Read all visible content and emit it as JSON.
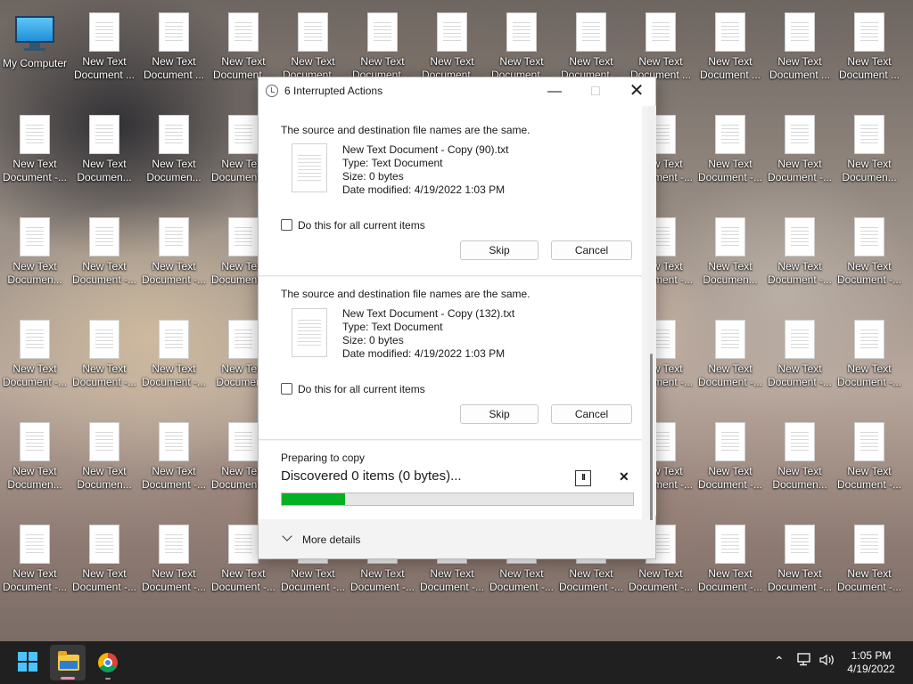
{
  "desktop": {
    "pc_label": "My Computer",
    "icons": [
      {
        "l1": "New Text",
        "l2": "Document ..."
      },
      {
        "l1": "New Text",
        "l2": "Document ..."
      },
      {
        "l1": "New Text",
        "l2": "Document ..."
      },
      {
        "l1": "New Text",
        "l2": "Document ..."
      },
      {
        "l1": "New Text",
        "l2": "Document ..."
      },
      {
        "l1": "New Text",
        "l2": "Document ..."
      },
      {
        "l1": "New Text",
        "l2": "Document ..."
      },
      {
        "l1": "New Text",
        "l2": "Document ..."
      },
      {
        "l1": "New Text",
        "l2": "Document ..."
      },
      {
        "l1": "New Text",
        "l2": "Document ..."
      },
      {
        "l1": "New Text",
        "l2": "Document ..."
      },
      {
        "l1": "New Text",
        "l2": "Document ..."
      },
      {
        "l1": "New Text",
        "l2": "Document -..."
      },
      {
        "l1": "New Text",
        "l2": "Documen..."
      },
      {
        "l1": "New Text",
        "l2": "Documen..."
      },
      {
        "l1": "New Text",
        "l2": "Document -..."
      },
      {
        "l1": "New Text",
        "l2": "Document -..."
      },
      {
        "l1": "New Text",
        "l2": "Document -..."
      },
      {
        "l1": "New Text",
        "l2": "Document -..."
      },
      {
        "l1": "New Text",
        "l2": "Documen..."
      },
      {
        "l1": "New Text",
        "l2": "Documen..."
      },
      {
        "l1": "New Text",
        "l2": "Document -..."
      },
      {
        "l1": "New Text",
        "l2": "Document -..."
      },
      {
        "l1": "New Text",
        "l2": "Document -..."
      },
      {
        "l1": "New Text",
        "l2": "Document -..."
      },
      {
        "l1": "New Text",
        "l2": "Documen..."
      },
      {
        "l1": "New Text",
        "l2": "Document -..."
      },
      {
        "l1": "New Text",
        "l2": "Document -..."
      },
      {
        "l1": "New Text",
        "l2": "Document -..."
      },
      {
        "l1": "New Text",
        "l2": "Document -..."
      },
      {
        "l1": "New Text",
        "l2": "Document -..."
      },
      {
        "l1": "New Text",
        "l2": "Documen..."
      },
      {
        "l1": "New Text",
        "l2": "Document -..."
      },
      {
        "l1": "New Text",
        "l2": "Document -..."
      },
      {
        "l1": "New Text",
        "l2": "Document -..."
      },
      {
        "l1": "New Text",
        "l2": "Document -..."
      },
      {
        "l1": "New Text",
        "l2": "Documen..."
      },
      {
        "l1": "New Text",
        "l2": "Documen..."
      },
      {
        "l1": "New Text",
        "l2": "Document -..."
      },
      {
        "l1": "New Text",
        "l2": "Document -..."
      },
      {
        "l1": "New Text",
        "l2": "Document -..."
      },
      {
        "l1": "New Text",
        "l2": "Document -..."
      },
      {
        "l1": "New Text",
        "l2": "Documen..."
      },
      {
        "l1": "New Text",
        "l2": "Document -..."
      },
      {
        "l1": "New Text",
        "l2": "Document -..."
      },
      {
        "l1": "New Text",
        "l2": "Document -..."
      },
      {
        "l1": "New Text",
        "l2": "Document -..."
      },
      {
        "l1": "New Text",
        "l2": "Document -..."
      },
      {
        "l1": "New Text",
        "l2": "Document -..."
      },
      {
        "l1": "New Text",
        "l2": "Document -..."
      },
      {
        "l1": "New Text",
        "l2": "Document -..."
      },
      {
        "l1": "New Text",
        "l2": "Document -..."
      },
      {
        "l1": "New Text",
        "l2": "Document -..."
      },
      {
        "l1": "New Text",
        "l2": "Document -..."
      },
      {
        "l1": "New Text",
        "l2": "Document -..."
      },
      {
        "l1": "New Text",
        "l2": "Document -..."
      },
      {
        "l1": "New Text",
        "l2": "Document -..."
      },
      {
        "l1": "New Text",
        "l2": "Document -..."
      },
      {
        "l1": "New Text",
        "l2": "Document -..."
      },
      {
        "l1": "New Text",
        "l2": "Document -..."
      },
      {
        "l1": "New Text",
        "l2": "Document -..."
      },
      {
        "l1": "New Text",
        "l2": "Document -..."
      },
      {
        "l1": "New Text",
        "l2": "Document -..."
      },
      {
        "l1": "New Text",
        "l2": "Document -..."
      },
      {
        "l1": "New Text",
        "l2": "Document -..."
      },
      {
        "l1": "New Text",
        "l2": "Document -..."
      }
    ]
  },
  "dialog": {
    "title": "6 Interrupted Actions",
    "conflicts": [
      {
        "heading": "The source and destination file names are the same.",
        "name": "New Text Document - Copy (90).txt",
        "type": "Type: Text Document",
        "size": "Size: 0 bytes",
        "date": "Date modified: 4/19/2022 1:03 PM",
        "checkbox": "Do this for all current items",
        "skip": "Skip",
        "cancel": "Cancel"
      },
      {
        "heading": "The source and destination file names are the same.",
        "name": "New Text Document - Copy (132).txt",
        "type": "Type: Text Document",
        "size": "Size: 0 bytes",
        "date": "Date modified: 4/19/2022 1:03 PM",
        "checkbox": "Do this for all current items",
        "skip": "Skip",
        "cancel": "Cancel"
      }
    ],
    "progress": {
      "status": "Preparing to copy",
      "detail": "Discovered 0 items (0 bytes)...",
      "fraction": 0.18
    },
    "more_details": "More details"
  },
  "taskbar": {
    "time": "1:05 PM",
    "date": "4/19/2022"
  },
  "colors": {
    "progress_fill": "#06b025",
    "start_accent": "#4cc2ff",
    "taskbar_bg": "#202020"
  },
  "icons": [
    "windows-start-icon",
    "file-explorer-icon",
    "chrome-icon",
    "chevron-up-icon",
    "network-icon",
    "volume-icon"
  ]
}
